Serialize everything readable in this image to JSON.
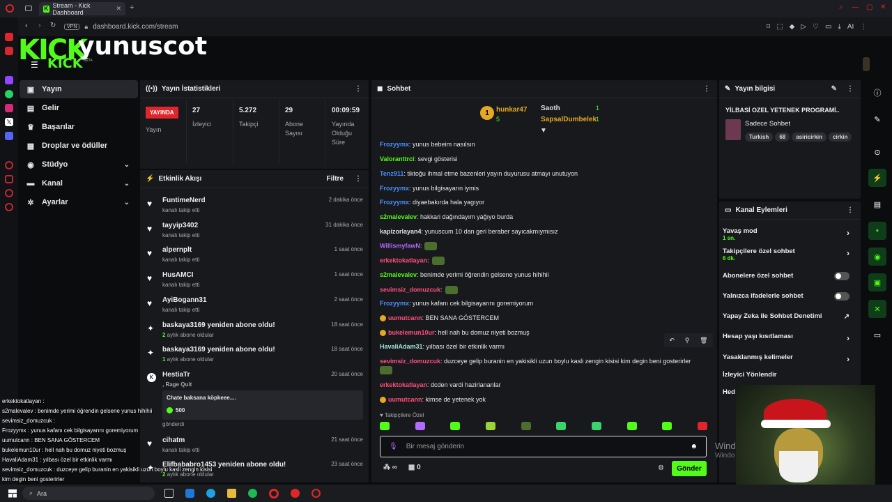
{
  "browser": {
    "tab_title": "Stream - Kick Dashboard",
    "tab_new": "+",
    "vpn": "VPN",
    "url": "dashboard.kick.com/stream",
    "ai": "AI"
  },
  "header": {
    "brand": "KICK",
    "channel": "yunuscot",
    "sub_brand": "KICK",
    "beta": "BETA"
  },
  "sidebar": {
    "items": [
      {
        "label": "Yayın",
        "icon": "video-icon"
      },
      {
        "label": "Gelir",
        "icon": "money-icon"
      },
      {
        "label": "Başarılar",
        "icon": "trophy-icon"
      },
      {
        "label": "Droplar ve ödüller",
        "icon": "gift-icon"
      },
      {
        "label": "Stüdyo",
        "icon": "studio-icon"
      },
      {
        "label": "Kanal",
        "icon": "channel-icon"
      },
      {
        "label": "Ayarlar",
        "icon": "gear-icon"
      }
    ]
  },
  "stats": {
    "title": "Yayın İstatistikleri",
    "live_badge": "YAYINDA",
    "live_label": "Yayın",
    "viewers_value": "27",
    "viewers_label": "İzleyici",
    "followers_value": "5.272",
    "followers_label": "Takipçi",
    "subs_value": "29",
    "subs_label1": "Abone",
    "subs_label2": "Sayısı",
    "duration_value": "00:09:59",
    "duration_label1": "Yayında",
    "duration_label2": "Olduğu",
    "duration_label3": "Süre"
  },
  "activity": {
    "title": "Etkinlik Akışı",
    "filter": "Filtre",
    "events": [
      {
        "name": "FuntimeNerd",
        "sub": "kanalı takip etti",
        "time": "2 dakika önce"
      },
      {
        "name": "tayyip3402",
        "sub": "kanalı takip etti",
        "time": "31 dakika önce"
      },
      {
        "name": "alpernplt",
        "sub": "kanalı takip etti",
        "time": "1 saat önce"
      },
      {
        "name": "HusAMCI",
        "sub": "kanalı takip etti",
        "time": "1 saat önce"
      },
      {
        "name": "AyiBogann31",
        "sub": "kanalı takip etti",
        "time": "2 saat önce"
      },
      {
        "name": "baskaya3169 yeniden abone oldu!",
        "sub_num": "2",
        "sub": " aylık abone oldular",
        "time": "18 saat önce"
      },
      {
        "name": "baskaya3169 yeniden abone oldu!",
        "sub_num": "1",
        "sub": " aylık abone oldular",
        "time": "18 saat önce"
      },
      {
        "name": "HestiaTr",
        "sub": ", Rage Quit",
        "time": "20 saat önce",
        "quote": "Chate baksana köpkeee....",
        "amount": "500",
        "extra": "gönderdi"
      },
      {
        "name": "cihatm",
        "sub": "kanalı takip etti",
        "time": "21 saat önce"
      },
      {
        "name": "Elifbababro1453 yeniden abone oldu!",
        "sub_num": "2",
        "sub": " aylık abone oldular",
        "time": "23 saat önce"
      }
    ]
  },
  "chat": {
    "title": "Sohbet",
    "top1_name": "hunkar47",
    "top1_rank": "1",
    "top1_count": "5",
    "top2_name": "Saoth",
    "top2_count": "1",
    "top3_name": "SapsalDumbelek",
    "top3_count": "1",
    "messages": [
      {
        "user": "Frozyymx",
        "color": "#4a90ff",
        "text": ": yunus bebeim nasılsın"
      },
      {
        "user": "Valoranttrci",
        "color": "#53fc18",
        "text": ": sevgi gösterisi"
      },
      {
        "user": "Tenz911",
        "color": "#4a90ff",
        "text": ": tiktoğu ihmal etme bazenleri yayın duyurusu atmayı unutuyon"
      },
      {
        "user": "Frozyymx",
        "color": "#4a90ff",
        "text": ": yunus bilgisayarın iymis"
      },
      {
        "user": "Frozyymx",
        "color": "#4a90ff",
        "text": ": diyaebakırda hala yagıyor"
      },
      {
        "user": "s2malevalev",
        "color": "#53fc18",
        "text": ": hakkari dağındayım yağıyo burda"
      },
      {
        "user": "kapizorlayan4",
        "color": "#e0e0e0",
        "text": ": yunuscum 10 dan geri beraber sayıcakmıymısız"
      },
      {
        "user": "WillismyfawN",
        "color": "#b36bff",
        "text": ":",
        "emote": true
      },
      {
        "user": "erkektokatlayan",
        "color": "#ff4f7b",
        "text": ":",
        "emote": true
      },
      {
        "user": "s2malevalev",
        "color": "#53fc18",
        "text": ": benimde yerimi öğrendin gelsene yunus hihihii"
      },
      {
        "user": "sevimsiz_domuzcuk",
        "color": "#ff4f7b",
        "text": ":",
        "emote": true
      },
      {
        "user": "Frozyymx",
        "color": "#4a90ff",
        "text": ": yunus kafanı cek bilgisayarını goremiyorum"
      },
      {
        "user": "uumutcann",
        "color": "#ff4f7b",
        "text": ": BEN SANA GÖSTERCEM",
        "badges": true
      },
      {
        "user": "bukelemun10ur",
        "color": "#ff4f7b",
        "text": ": hell nah bu domuz niyeti bozmuş",
        "badges": true
      },
      {
        "user": "HavaliAdam31",
        "color": "#a3e4d7",
        "text": ": yılbası özel bir etkinlik varmı"
      },
      {
        "user": "sevimsiz_domuzcuk",
        "color": "#ff4f7b",
        "text": ": duzceye gelip buranin en yakisikli uzun boylu kasli zengin kisisi kim degin beni gosterirler"
      },
      {
        "user": "erkektokatlayan",
        "color": "#ff4f7b",
        "text": ": dcden vardi hazirlananlar"
      },
      {
        "user": "uumutcann",
        "color": "#ff4f7b",
        "text": ": kimse de yetenek yok",
        "badges": true
      }
    ],
    "followers_only": "Takipçilere Özel",
    "input_placeholder": "Bir mesaj gönderin",
    "points": "∞",
    "gifts": "0",
    "send": "Gönder"
  },
  "stream_info": {
    "title": "Yayın bilgisi",
    "stream_title": "YİLBASİ OZEL YETENEK PROGRAMİ..",
    "category": "Sadece Sohbet",
    "tags": [
      "Turkish",
      "68",
      "asiricirkin",
      "cirkin"
    ]
  },
  "channel_actions": {
    "title": "Kanal Eylemleri",
    "slow_mode": "Yavaş mod",
    "slow_mode_value": "1 sn.",
    "followers_chat": "Takipçilere özel sohbet",
    "followers_chat_value": "6 dk.",
    "subs_chat": "Abonelere özel sohbet",
    "emotes_chat": "Yalnızca ifadelerle sohbet",
    "ai_moderation": "Yapay Zeka ile Sohbet Denetimi",
    "age_restriction": "Hesap yaşı kısıtlaması",
    "banned_words": "Yasaklanmış kelimeler",
    "redirect": "İzleyici Yönlendir",
    "hidden": "Hed"
  },
  "overlay_chat": [
    "erkektokatlayan :",
    "s2malevalev : benimde yerimi öğrendin gelsene yunus hihihii",
    "sevimsiz_domuzcuk :",
    "Frozyymx : yunus kafanı cek bilgisayarını goremiyorum",
    "uumutcann : BEN SANA GÖSTERCEM",
    "bukelemun10ur : hell nah bu domuz niyeti bozmuş",
    "HavaliAdam31 : yılbası özel bir etkinlik varmı",
    "sevimsiz_domuzcuk : duzceye gelip buranin en yakisikli uzun boylu kasli zengin kisisi",
    "kim degin beni gosterirler",
    "erkektokatlayan : dcden vardi hazirlananlar",
    "uumutcann : kimse de yetenek yok"
  ],
  "taskbar": {
    "search": "Ara"
  },
  "windows_watermark": "Wind",
  "windows_watermark2": "Windo",
  "accent": "#53fc18"
}
